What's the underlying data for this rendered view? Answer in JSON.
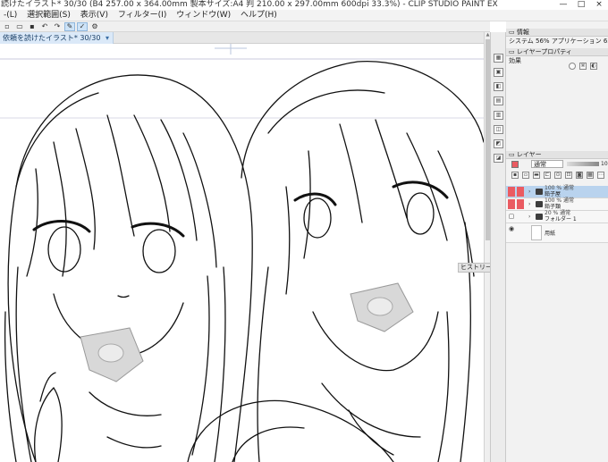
{
  "window": {
    "title": "読けたイラスト* 30/30 (B4 257.00 x 364.00mm 製本サイズ:A4 判 210.00 x 297.00mm 600dpi 33.3%) - CLIP STUDIO PAINT EX",
    "controls": [
      "—",
      "□",
      "×"
    ]
  },
  "menu": {
    "items": [
      "-(L)",
      "選択範囲(S)",
      "表示(V)",
      "フィルター(I)",
      "ウィンドウ(W)",
      "ヘルプ(H)"
    ]
  },
  "toolbar": {
    "buttons": [
      "new-icon",
      "open-icon",
      "save-icon",
      "undo-icon",
      "redo-icon",
      "pen-icon",
      "check-icon",
      "settings-icon"
    ]
  },
  "canvas_tab": {
    "label": "依頼を読けたイラスト* 30/30",
    "arrow": "▾"
  },
  "history_panel": {
    "title": "ヒストリー"
  },
  "right_panel": {
    "info": {
      "title": "情報",
      "system": "システム 56%",
      "application": "アプリケーション 65%"
    },
    "layer_property": {
      "title": "レイヤープロパティ",
      "effect_label": "効果"
    },
    "layer_panel": {
      "title": "レイヤー",
      "blend_mode": "通常",
      "opacity": "100"
    },
    "layers": [
      {
        "info": "100 % 通常",
        "name": "鉛子屋",
        "selected": true,
        "marked": true
      },
      {
        "info": "100 % 通常",
        "name": "鉛子類",
        "selected": false,
        "marked": true
      },
      {
        "info": "20 % 通常",
        "name": "フォルダー 1",
        "selected": false,
        "marked": false
      },
      {
        "info": "",
        "name": "用紙",
        "selected": false,
        "marked": false
      }
    ]
  },
  "colors": {
    "accent": "#3a6ea5",
    "selected_layer": "#b9d3ee",
    "mark_red": "#ea5b62"
  }
}
